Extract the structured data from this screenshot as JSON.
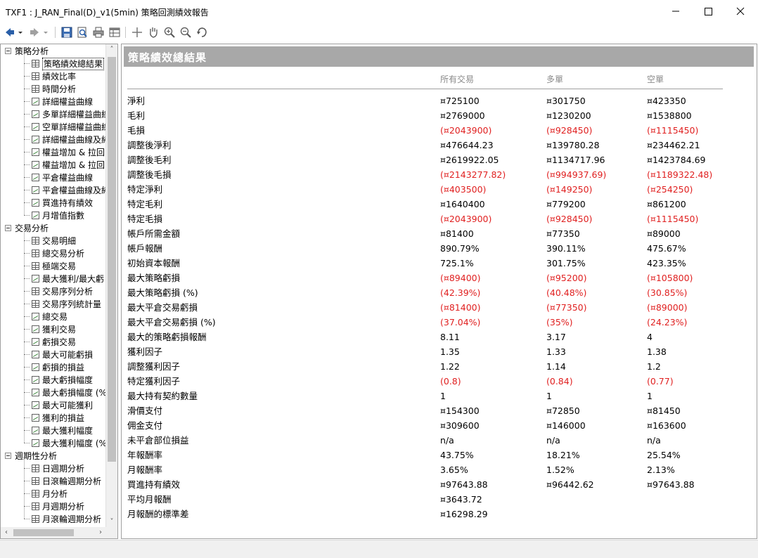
{
  "window": {
    "title": "TXF1 : J_RAN_Final(D)_v1(5min) 策略回測績效報告",
    "minimize_icon": "minimize-icon",
    "maximize_icon": "maximize-icon",
    "close_icon": "close-icon"
  },
  "toolbar": {
    "icons": [
      "back-arrow-icon",
      "dropdown-arrow-icon",
      "forward-arrow-icon",
      "dropdown-arrow-icon",
      "save-icon",
      "print-preview-icon",
      "print-icon",
      "table-icon",
      "crosshair-icon",
      "hand-pan-icon",
      "zoom-in-icon",
      "zoom-out-icon",
      "reset-icon"
    ]
  },
  "tree": {
    "groups": [
      {
        "label": "策略分析",
        "items": [
          {
            "label": "策略績效總結果",
            "icon": "grid"
          },
          {
            "label": "績效比率",
            "icon": "grid"
          },
          {
            "label": "時間分析",
            "icon": "grid"
          },
          {
            "label": "詳細權益曲線",
            "icon": "chart"
          },
          {
            "label": "多單詳細權益曲線",
            "icon": "chart"
          },
          {
            "label": "空單詳細權益曲線",
            "icon": "chart"
          },
          {
            "label": "詳細權益曲線及純",
            "icon": "chart"
          },
          {
            "label": "權益增加 & 拉回",
            "icon": "chart"
          },
          {
            "label": "權益增加 & 拉回(",
            "icon": "chart"
          },
          {
            "label": "平倉權益曲線",
            "icon": "chart"
          },
          {
            "label": "平倉權益曲線及純",
            "icon": "chart"
          },
          {
            "label": "買進持有績效",
            "icon": "chart"
          },
          {
            "label": "月增值指數",
            "icon": "chart"
          }
        ]
      },
      {
        "label": "交易分析",
        "items": [
          {
            "label": "交易明細",
            "icon": "grid"
          },
          {
            "label": "總交易分析",
            "icon": "grid"
          },
          {
            "label": "極端交易",
            "icon": "grid"
          },
          {
            "label": "最大獲利/最大虧",
            "icon": "chart"
          },
          {
            "label": "交易序列分析",
            "icon": "grid"
          },
          {
            "label": "交易序列統計量",
            "icon": "grid"
          },
          {
            "label": "總交易",
            "icon": "chart"
          },
          {
            "label": "獲利交易",
            "icon": "chart"
          },
          {
            "label": "虧損交易",
            "icon": "chart"
          },
          {
            "label": "最大可能虧損",
            "icon": "chart"
          },
          {
            "label": "虧損的損益",
            "icon": "chart"
          },
          {
            "label": "最大虧損幅度",
            "icon": "chart"
          },
          {
            "label": "最大虧損幅度 (%",
            "icon": "chart"
          },
          {
            "label": "最大可能獲利",
            "icon": "chart"
          },
          {
            "label": "獲利的損益",
            "icon": "chart"
          },
          {
            "label": "最大獲利幅度",
            "icon": "chart"
          },
          {
            "label": "最大獲利幅度 (%",
            "icon": "chart"
          }
        ]
      },
      {
        "label": "週期性分析",
        "items": [
          {
            "label": "日週期分析",
            "icon": "grid"
          },
          {
            "label": "日滾輪週期分析",
            "icon": "grid"
          },
          {
            "label": "月分析",
            "icon": "grid"
          },
          {
            "label": "月週期分析",
            "icon": "grid"
          },
          {
            "label": "月滾輪週期分析",
            "icon": "grid"
          }
        ]
      }
    ]
  },
  "report": {
    "header": "策略績效總結果",
    "columns": [
      "所有交易",
      "多單",
      "空單"
    ],
    "rows": [
      {
        "label": "淨利",
        "vals": [
          "¤725100",
          "¤301750",
          "¤423350"
        ],
        "neg": false
      },
      {
        "label": "毛利",
        "vals": [
          "¤2769000",
          "¤1230200",
          "¤1538800"
        ],
        "neg": false
      },
      {
        "label": "毛損",
        "vals": [
          "(¤2043900)",
          "(¤928450)",
          "(¤1115450)"
        ],
        "neg": true
      },
      {
        "label": "調整後淨利",
        "vals": [
          "¤476644.23",
          "¤139780.28",
          "¤234462.21"
        ],
        "neg": false
      },
      {
        "label": "調整後毛利",
        "vals": [
          "¤2619922.05",
          "¤1134717.96",
          "¤1423784.69"
        ],
        "neg": false
      },
      {
        "label": "調整後毛損",
        "vals": [
          "(¤2143277.82)",
          "(¤994937.69)",
          "(¤1189322.48)"
        ],
        "neg": true
      },
      {
        "label": "特定淨利",
        "vals": [
          "(¤403500)",
          "(¤149250)",
          "(¤254250)"
        ],
        "neg": true
      },
      {
        "label": "特定毛利",
        "vals": [
          "¤1640400",
          "¤779200",
          "¤861200"
        ],
        "neg": false
      },
      {
        "label": "特定毛損",
        "vals": [
          "(¤2043900)",
          "(¤928450)",
          "(¤1115450)"
        ],
        "neg": true
      },
      {
        "label": "帳戶所需金額",
        "vals": [
          "¤81400",
          "¤77350",
          "¤89000"
        ],
        "neg": false
      },
      {
        "label": "帳戶報酬",
        "vals": [
          "890.79%",
          "390.11%",
          "475.67%"
        ],
        "neg": false
      },
      {
        "label": "初始資本報酬",
        "vals": [
          "725.1%",
          "301.75%",
          "423.35%"
        ],
        "neg": false
      },
      {
        "label": "最大策略虧損",
        "vals": [
          "(¤89400)",
          "(¤95200)",
          "(¤105800)"
        ],
        "neg": true
      },
      {
        "label": "最大策略虧損 (%)",
        "vals": [
          "(42.39%)",
          "(40.48%)",
          "(30.85%)"
        ],
        "neg": true
      },
      {
        "label": "最大平倉交易虧損",
        "vals": [
          "(¤81400)",
          "(¤77350)",
          "(¤89000)"
        ],
        "neg": true
      },
      {
        "label": "最大平倉交易虧損 (%)",
        "vals": [
          "(37.04%)",
          "(35%)",
          "(24.23%)"
        ],
        "neg": true
      },
      {
        "label": "最大的策略虧損報酬",
        "vals": [
          "8.11",
          "3.17",
          "4"
        ],
        "neg": false
      },
      {
        "label": "獲利因子",
        "vals": [
          "1.35",
          "1.33",
          "1.38"
        ],
        "neg": false
      },
      {
        "label": "調整獲利因子",
        "vals": [
          "1.22",
          "1.14",
          "1.2"
        ],
        "neg": false
      },
      {
        "label": "特定獲利因子",
        "vals": [
          "(0.8)",
          "(0.84)",
          "(0.77)"
        ],
        "neg": true
      },
      {
        "label": "最大持有契約數量",
        "vals": [
          "1",
          "1",
          "1"
        ],
        "neg": false
      },
      {
        "label": "滑價支付",
        "vals": [
          "¤154300",
          "¤72850",
          "¤81450"
        ],
        "neg": false
      },
      {
        "label": "佣金支付",
        "vals": [
          "¤309600",
          "¤146000",
          "¤163600"
        ],
        "neg": false
      },
      {
        "label": "未平倉部位損益",
        "vals": [
          "n/a",
          "n/a",
          "n/a"
        ],
        "neg": false
      },
      {
        "label": "年報酬率",
        "vals": [
          "43.75%",
          "18.21%",
          "25.54%"
        ],
        "neg": false
      },
      {
        "label": "月報酬率",
        "vals": [
          "3.65%",
          "1.52%",
          "2.13%"
        ],
        "neg": false
      },
      {
        "label": "買進持有績效",
        "vals": [
          "¤97643.88",
          "¤96442.62",
          "¤97643.88"
        ],
        "neg": false
      },
      {
        "label": "平均月報酬",
        "vals": [
          "¤3643.72",
          "",
          ""
        ],
        "neg": false
      },
      {
        "label": "月報酬的標準差",
        "vals": [
          "¤16298.29",
          "",
          ""
        ],
        "neg": false
      }
    ]
  },
  "colors": {
    "header_bg": "#a8a8a8",
    "negative": "#e02020",
    "column_header": "#8a8a8a"
  }
}
